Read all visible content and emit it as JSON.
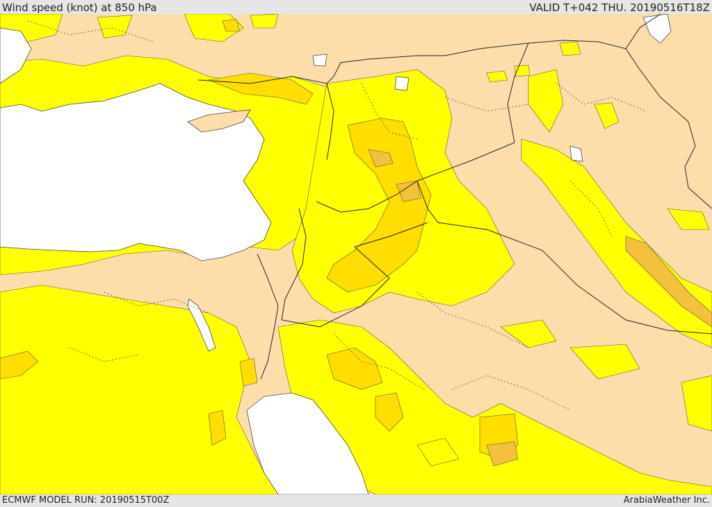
{
  "header": {
    "title": "Wind speed (knot) at 850 hPa",
    "valid_time": "VALID T+042 THU. 20190516T18Z"
  },
  "footer": {
    "model_run": "ECMWF MODEL RUN: 20190515T00Z",
    "credit": "ArabiaWeather Inc."
  },
  "colors": {
    "land": "#fddeab",
    "sea": "#ffffff",
    "band_low": "#ffff00",
    "band_mid": "#ffde00",
    "band_high": "#f3c13c",
    "bar": "#e6e6e6"
  }
}
